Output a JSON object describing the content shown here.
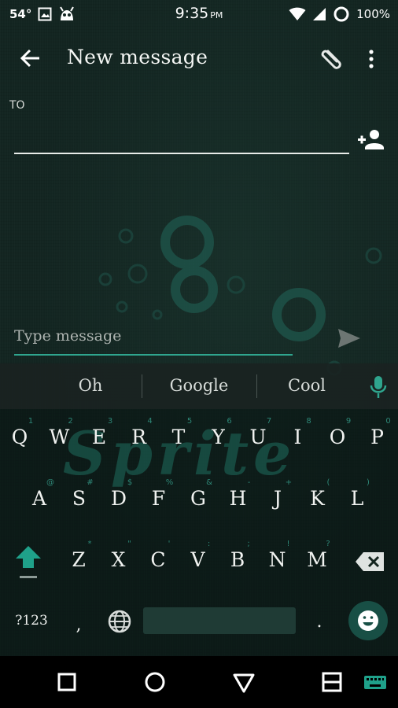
{
  "status_bar": {
    "temperature": "54°",
    "time": "9:35",
    "ampm": "PM",
    "battery": "100%"
  },
  "toolbar": {
    "title": "New message"
  },
  "recipient": {
    "label": "TO",
    "value": ""
  },
  "compose": {
    "placeholder": "Type message",
    "value": ""
  },
  "keyboard": {
    "suggestions": [
      "Oh",
      "Google",
      "Cool"
    ],
    "row1": [
      {
        "key": "Q",
        "hint": "1"
      },
      {
        "key": "W",
        "hint": "2"
      },
      {
        "key": "E",
        "hint": "3"
      },
      {
        "key": "R",
        "hint": "4"
      },
      {
        "key": "T",
        "hint": "5"
      },
      {
        "key": "Y",
        "hint": "6"
      },
      {
        "key": "U",
        "hint": "7"
      },
      {
        "key": "I",
        "hint": "8"
      },
      {
        "key": "O",
        "hint": "9"
      },
      {
        "key": "P",
        "hint": "0"
      }
    ],
    "row2": [
      {
        "key": "A",
        "hint": "@"
      },
      {
        "key": "S",
        "hint": "#"
      },
      {
        "key": "D",
        "hint": "$"
      },
      {
        "key": "F",
        "hint": "%"
      },
      {
        "key": "G",
        "hint": "&"
      },
      {
        "key": "H",
        "hint": "-"
      },
      {
        "key": "J",
        "hint": "+"
      },
      {
        "key": "K",
        "hint": "("
      },
      {
        "key": "L",
        "hint": ")"
      }
    ],
    "row3": [
      {
        "key": "Z",
        "hint": "*"
      },
      {
        "key": "X",
        "hint": "\""
      },
      {
        "key": "C",
        "hint": "'"
      },
      {
        "key": "V",
        "hint": ":"
      },
      {
        "key": "B",
        "hint": ";"
      },
      {
        "key": "N",
        "hint": "!"
      },
      {
        "key": "M",
        "hint": "?"
      }
    ],
    "symbols_label": "?123",
    "comma": ",",
    "period": ".",
    "watermark": "Sprite"
  },
  "colors": {
    "accent": "#2fa58e",
    "background": "#132521",
    "emoji_button": "#184f45"
  },
  "icons": [
    "arrow-back-icon",
    "paperclip-icon",
    "more-vert-icon",
    "person-add-icon",
    "send-icon",
    "mic-icon",
    "shift-icon",
    "backspace-icon",
    "globe-icon",
    "emoji-icon",
    "nav-overview-icon",
    "nav-home-icon",
    "nav-back-icon",
    "split-screen-icon",
    "keyboard-switch-icon"
  ]
}
